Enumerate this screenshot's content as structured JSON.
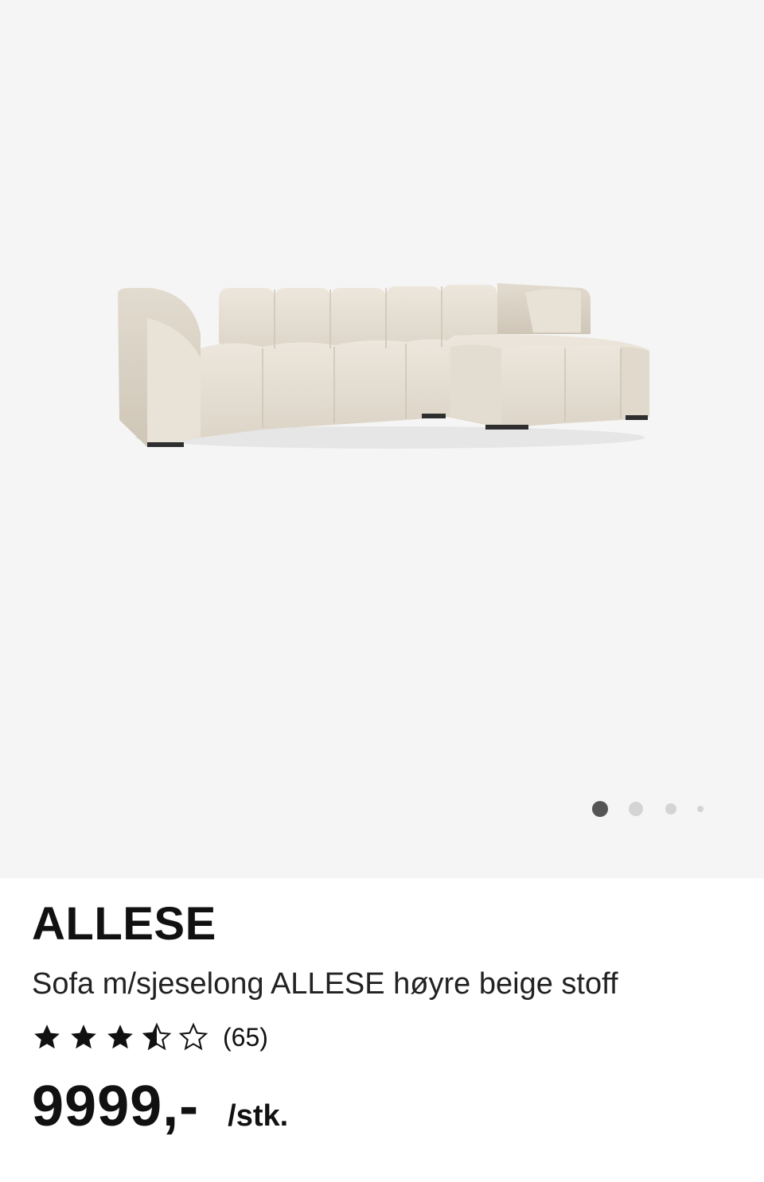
{
  "product": {
    "name": "ALLESE",
    "description": "Sofa m/sjeselong ALLESE høyre beige stoff",
    "rating": 3.5,
    "rating_max": 5,
    "review_count": "(65)",
    "price": "9999,-",
    "unit": "/stk."
  },
  "gallery": {
    "image_count": 4,
    "active_index": 0,
    "background": "#f5f5f5",
    "dot_active_color": "#555555",
    "dot_inactive_color": "#d4d4d4"
  },
  "icons": {
    "star_filled": "star-filled-icon",
    "star_half": "star-half-icon",
    "star_empty": "star-empty-icon"
  }
}
